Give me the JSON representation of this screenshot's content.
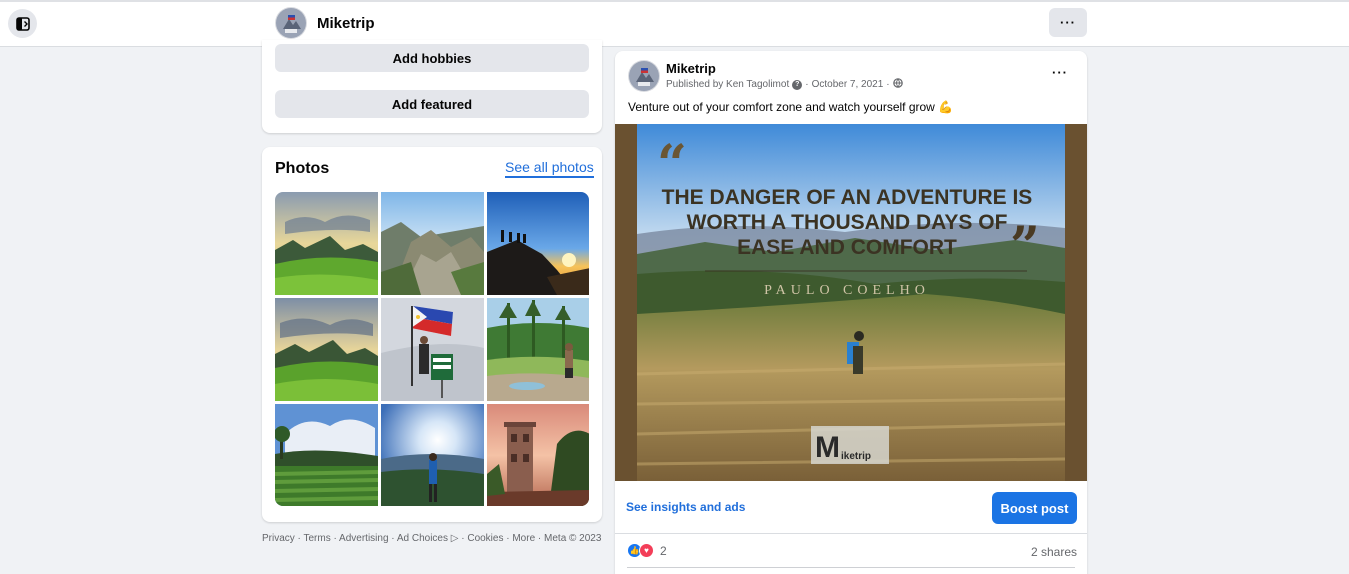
{
  "header": {
    "page_name": "Miketrip",
    "more_label": "···"
  },
  "intro": {
    "add_hobbies": "Add hobbies",
    "add_featured": "Add featured"
  },
  "photos": {
    "title": "Photos",
    "see_all": "See all photos",
    "items": [
      {
        "icon": "mountain-meadow-sunrise"
      },
      {
        "icon": "rocky-peak"
      },
      {
        "icon": "hikers-on-summit-sunset"
      },
      {
        "icon": "mountain-meadow-cloudy"
      },
      {
        "icon": "hiker-with-philippine-flag"
      },
      {
        "icon": "hiker-by-river"
      },
      {
        "icon": "cabbage-field-clouds"
      },
      {
        "icon": "hiker-sunburst-valley"
      },
      {
        "icon": "old-tower-sunset"
      }
    ]
  },
  "footer": {
    "links": "Privacy · Terms · Advertising · Ad Choices ▷ · Cookies · More · Meta © 2023"
  },
  "post": {
    "author": "Miketrip",
    "published_by": "Published by Ken Tagolimot",
    "date": "October 7, 2021",
    "separator": "·",
    "text": "Venture out of your comfort zone and watch yourself grow 💪",
    "quote_line1": "THE DANGER OF AN ADVENTURE IS",
    "quote_line2": "WORTH A THOUSAND DAYS OF",
    "quote_line3": "EASE AND COMFORT",
    "quote_author": "PAULO COELHO",
    "watermark": "iketrip",
    "watermark_letter": "M",
    "insights_link": "See insights and ads",
    "boost_label": "Boost post",
    "reaction_count": "2",
    "shares": "2 shares"
  },
  "colors": {
    "accent": "#1b74e4",
    "link": "#216fdb",
    "background": "#f0f2f5"
  }
}
